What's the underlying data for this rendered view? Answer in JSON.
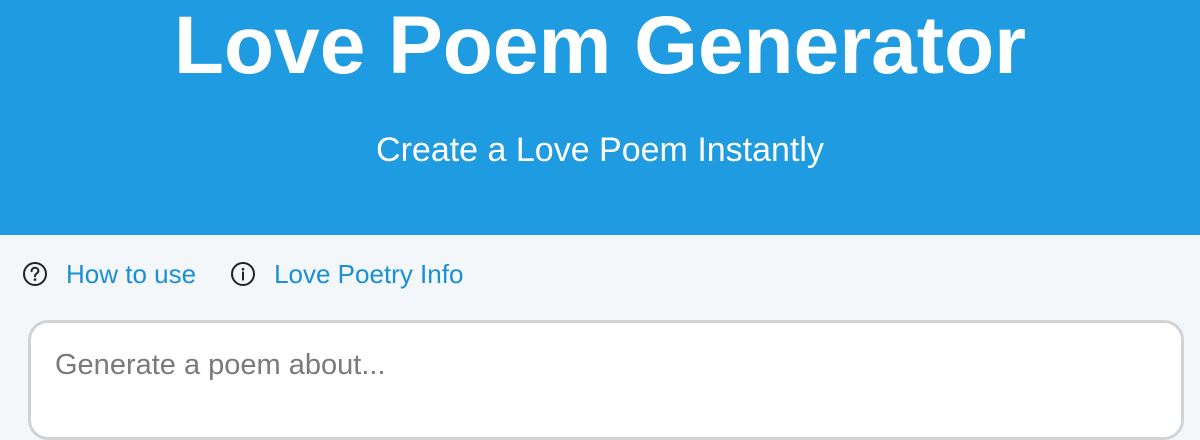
{
  "header": {
    "title": "Love Poem Generator",
    "subtitle": "Create a Love Poem Instantly",
    "background_color": "#1e9be1"
  },
  "links": [
    {
      "icon": "question-circle-icon",
      "label": "How to use"
    },
    {
      "icon": "info-circle-icon",
      "label": "Love Poetry Info"
    }
  ],
  "prompt": {
    "placeholder": "Generate a poem about...",
    "value": ""
  },
  "colors": {
    "accent": "#1e9be1",
    "link": "#1b8fd3",
    "page_background": "#f3f7fa"
  }
}
